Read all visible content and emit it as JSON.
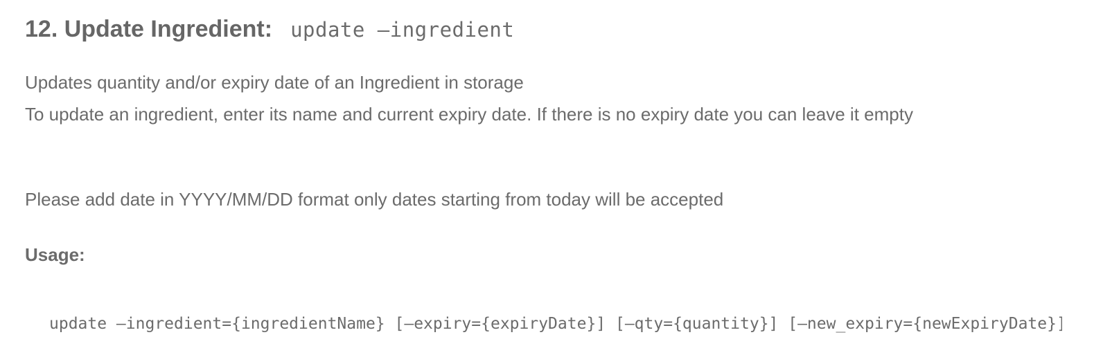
{
  "section": {
    "title": "12. Update Ingredient:",
    "command": "update –ingredient"
  },
  "description": {
    "line1": "Updates quantity and/or expiry date of an Ingredient in storage",
    "line2": "To update an ingredient, enter its name and current expiry date. If there is no expiry date you can leave it empty",
    "date_note": "Please add date in YYYY/MM/DD format only dates starting from today will be accepted"
  },
  "usage": {
    "label": "Usage:",
    "code": "update –ingredient={ingredientName} [–expiry={expiryDate}] [–qty={quantity}] [–new_expiry={newExpiryDate}]"
  }
}
